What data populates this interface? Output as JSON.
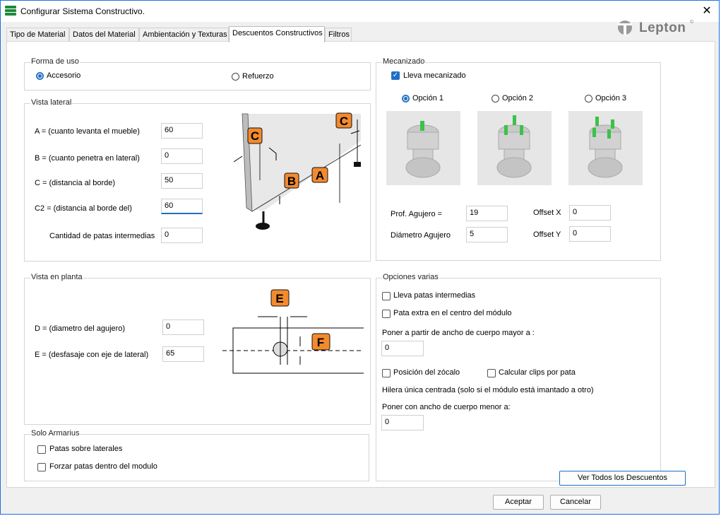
{
  "window": {
    "title": "Configurar Sistema Constructivo.",
    "close_symbol": "✕"
  },
  "tabs": [
    "Tipo de Material",
    "Datos del Material",
    "Ambientación y Texturas",
    "Descuentos Constructivos",
    "Filtros"
  ],
  "logo": {
    "text": "Lepton",
    "mark": "©"
  },
  "forma_de_uso": {
    "legend": "Forma de uso",
    "options": [
      "Accesorio",
      "Refuerzo"
    ],
    "selected": "Accesorio"
  },
  "vista_lateral": {
    "legend": "Vista lateral",
    "fields": [
      {
        "label": "A = (cuanto levanta el mueble)",
        "value": "60"
      },
      {
        "label": "B = (cuanto penetra en lateral)",
        "value": "0"
      },
      {
        "label": "C = (distancia al borde)",
        "value": "50"
      },
      {
        "label": "C2 = (distancia al borde del)",
        "value": "60"
      },
      {
        "label": "Cantidad de patas intermedias",
        "value": "0"
      }
    ],
    "diagram_labels": [
      "C",
      "C",
      "B",
      "A"
    ]
  },
  "vista_en_planta": {
    "legend": "Vista en planta",
    "fields": [
      {
        "label": "D = (diametro del agujero)",
        "value": "0"
      },
      {
        "label": "E = (desfasaje con eje de lateral)",
        "value": "65"
      }
    ],
    "diagram_labels": [
      "E",
      "F"
    ]
  },
  "solo_armarius": {
    "legend": "Solo Armarius",
    "checks": [
      {
        "label": "Patas sobre laterales",
        "checked": false
      },
      {
        "label": "Forzar patas dentro del modulo",
        "checked": false
      }
    ]
  },
  "mecanizado": {
    "legend": "Mecanizado",
    "lleva": {
      "label": "Lleva mecanizado",
      "checked": true
    },
    "options": [
      "Opción 1",
      "Opción 2",
      "Opción 3"
    ],
    "selected": "Opción 1",
    "fields": [
      {
        "label": "Prof. Agujero =",
        "value": "19"
      },
      {
        "label": "Diámetro Agujero",
        "value": "5"
      },
      {
        "label": "Offset X",
        "value": "0"
      },
      {
        "label": "Offset Y",
        "value": "0"
      }
    ]
  },
  "opciones_varias": {
    "legend": "Opciones varias",
    "patas_intermedias": {
      "label": "Lleva patas intermedias",
      "checked": false
    },
    "pata_extra": {
      "label": "Pata extra en el centro del módulo",
      "checked": false
    },
    "poner_mayor_label": "Poner a partir de ancho de cuerpo mayor a :",
    "poner_mayor_value": "0",
    "posicion_zocalo": {
      "label": "Posición del zócalo",
      "checked": false
    },
    "calcular_clips": {
      "label": "Calcular clips por pata",
      "checked": false
    },
    "hilera_label": "Hilera única centrada (solo si el módulo está imantado a otro)",
    "poner_menor_label": "Poner con ancho de cuerpo menor a:",
    "poner_menor_value": "0"
  },
  "buttons": {
    "ver_todos": "Ver Todos los Descuentos",
    "aceptar": "Aceptar",
    "cancelar": "Cancelar"
  },
  "colors": {
    "accent": "#1f6fc5",
    "badge": "#f28a2e",
    "logo": "#7a7a7a",
    "app_icon": "#1f8a3a",
    "window_border": "#1a73e8"
  }
}
